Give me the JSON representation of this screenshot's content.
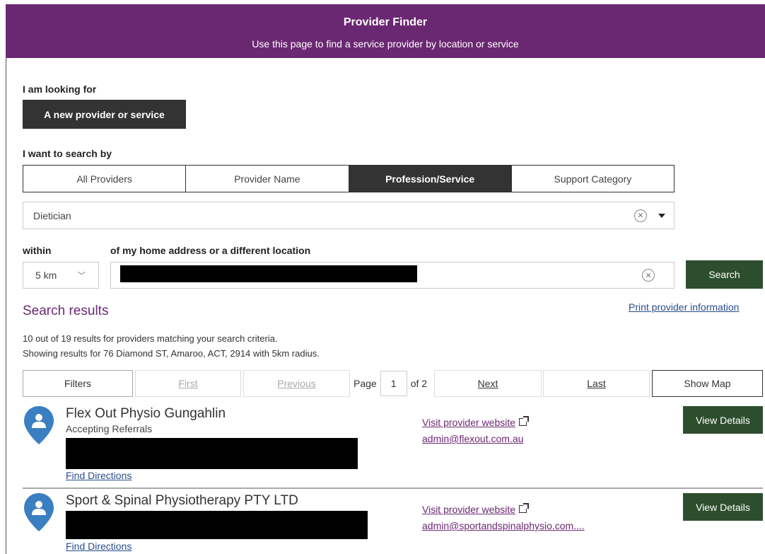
{
  "header": {
    "title": "Provider Finder",
    "subtitle": "Use this page to find a service provider by location or service",
    "color": "#6b2872"
  },
  "looking_for": {
    "label": "I am looking for",
    "button": "A new provider or service"
  },
  "search_by": {
    "label": "I want to search by",
    "tabs": [
      {
        "label": "All Providers",
        "active": false
      },
      {
        "label": "Provider Name",
        "active": false
      },
      {
        "label": "Profession/Service",
        "active": true
      },
      {
        "label": "Support Category",
        "active": false
      }
    ]
  },
  "service_select": {
    "value": "Dietician"
  },
  "location": {
    "within_label": "within",
    "location_label": "of my home address or a different location",
    "distance_value": "5 km",
    "search_button": "Search",
    "accent": "#2d4e2d"
  },
  "results": {
    "title": "Search results",
    "print_link": "Print provider information",
    "summary_line1": "10 out of 19 results for providers matching your search criteria.",
    "summary_line2": "Showing results for 76 Diamond ST, Amaroo, ACT, 2914 with 5km radius."
  },
  "pager": {
    "filters": "Filters",
    "first": "First",
    "previous": "Previous",
    "page_label": "Page",
    "page_value": "1",
    "of_label": "of 2",
    "next": "Next",
    "last": "Last",
    "show_map": "Show Map"
  },
  "providers": [
    {
      "name": "Flex Out Physio Gungahlin",
      "status": "Accepting Referrals",
      "website_link": "Visit provider website",
      "email": "admin@flexout.com.au",
      "directions": "Find Directions",
      "details_button": "View Details",
      "icon": "map-pin-person-icon"
    },
    {
      "name": "Sport & Spinal Physiotherapy PTY LTD",
      "status": "",
      "website_link": "Visit provider website",
      "email": "admin@sportandspinalphysio.com....",
      "directions": "Find Directions",
      "details_button": "View Details",
      "icon": "map-pin-person-icon"
    }
  ]
}
